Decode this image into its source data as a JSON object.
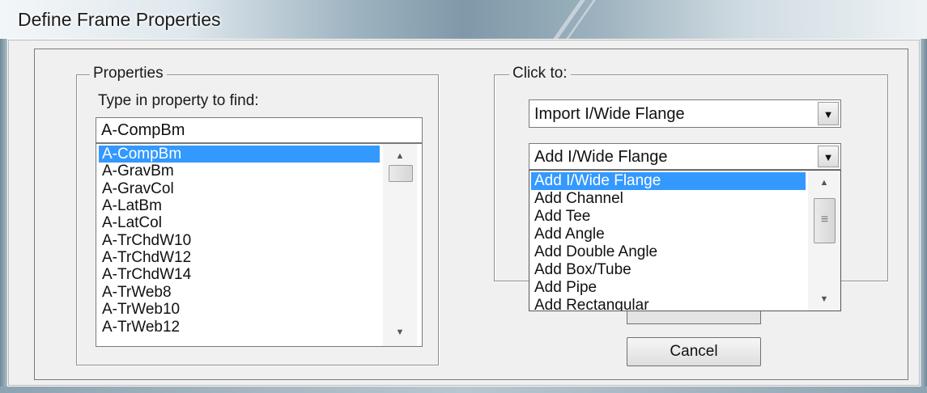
{
  "window": {
    "title": "Define Frame Properties"
  },
  "properties": {
    "group_label": "Properties",
    "find_label": "Type in property to find:",
    "find_value": "A-CompBm",
    "items": [
      "A-CompBm",
      "A-GravBm",
      "A-GravCol",
      "A-LatBm",
      "A-LatCol",
      "A-TrChdW10",
      "A-TrChdW12",
      "A-TrChdW14",
      "A-TrWeb8",
      "A-TrWeb10",
      "A-TrWeb12"
    ],
    "selected": "A-CompBm"
  },
  "click_to": {
    "group_label": "Click to:",
    "import_combo": {
      "value": "Import I/Wide Flange"
    },
    "add_combo": {
      "value": "Add I/Wide Flange",
      "options": [
        "Add I/Wide Flange",
        "Add Channel",
        "Add Tee",
        "Add Angle",
        "Add Double Angle",
        "Add Box/Tube",
        "Add Pipe",
        "Add Rectangular"
      ],
      "highlighted": "Add I/Wide Flange"
    }
  },
  "buttons": {
    "cancel": "Cancel"
  },
  "icons": {
    "scroll_up": "▲",
    "scroll_down": "▼",
    "dropdown_arrow": "▼",
    "grip": "≡"
  },
  "colors": {
    "selection": "#3399ff",
    "dialog_bg": "#f0f0f0"
  }
}
